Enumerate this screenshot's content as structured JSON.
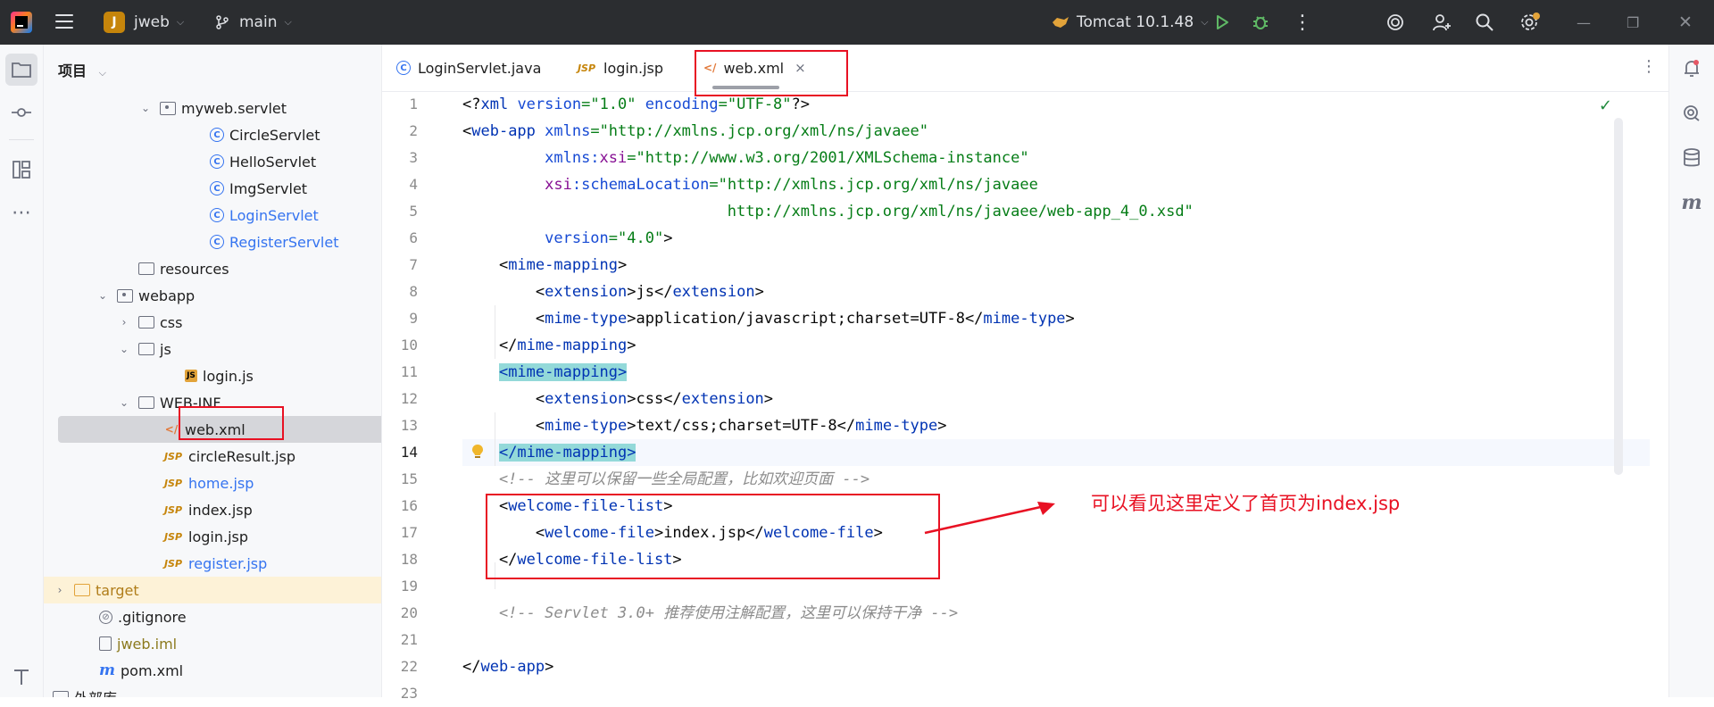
{
  "titlebar": {
    "project_badge": "J",
    "project_name": "jweb",
    "branch": "main",
    "run_config": "Tomcat 10.1.48"
  },
  "project_panel": {
    "header": "项目",
    "tree": [
      {
        "label": "myweb.servlet",
        "icon": "package-icon",
        "arrow": "⌄",
        "indent": 130
      },
      {
        "label": "CircleServlet",
        "icon": "class-icon",
        "indent": 186
      },
      {
        "label": "HelloServlet",
        "icon": "class-icon",
        "indent": 186
      },
      {
        "label": "ImgServlet",
        "icon": "class-icon",
        "indent": 186
      },
      {
        "label": "LoginServlet",
        "icon": "class-icon",
        "indent": 186,
        "color": "blue"
      },
      {
        "label": "RegisterServlet",
        "icon": "class-icon",
        "indent": 186,
        "color": "blue"
      },
      {
        "label": "resources",
        "icon": "resources-folder-icon",
        "indent": 106
      },
      {
        "label": "webapp",
        "icon": "web-folder-icon",
        "arrow": "⌄",
        "indent": 82
      },
      {
        "label": "css",
        "icon": "folder-icon",
        "arrow": "›",
        "indent": 106
      },
      {
        "label": "js",
        "icon": "folder-icon",
        "arrow": "⌄",
        "indent": 106
      },
      {
        "label": "login.js",
        "icon": "js-file-icon",
        "indent": 158
      },
      {
        "label": "WEB-INF",
        "icon": "folder-icon",
        "arrow": "⌄",
        "indent": 106
      },
      {
        "label": "web.xml",
        "icon": "xml-file-icon",
        "indent": 134,
        "selected": true
      },
      {
        "label": "circleResult.jsp",
        "icon": "jsp-file-icon",
        "indent": 134
      },
      {
        "label": "home.jsp",
        "icon": "jsp-file-icon",
        "indent": 134,
        "color": "blue"
      },
      {
        "label": "index.jsp",
        "icon": "jsp-file-icon",
        "indent": 134
      },
      {
        "label": "login.jsp",
        "icon": "jsp-file-icon",
        "indent": 134
      },
      {
        "label": "register.jsp",
        "icon": "jsp-file-icon",
        "indent": 134,
        "color": "blue"
      },
      {
        "label": "target",
        "icon": "excluded-folder-icon",
        "arrow": "›",
        "indent": 34,
        "highlight": true,
        "color": "orange"
      },
      {
        "label": ".gitignore",
        "icon": "gitignore-icon",
        "indent": 62
      },
      {
        "label": "jweb.iml",
        "icon": "iml-file-icon",
        "indent": 62,
        "color": "olive"
      },
      {
        "label": "pom.xml",
        "icon": "maven-icon",
        "indent": 62
      },
      {
        "label": "外部库",
        "icon": "library-icon",
        "arrow": "⌄",
        "indent": 10
      }
    ]
  },
  "editor": {
    "tabs": [
      {
        "label": "LoginServlet.java",
        "icon": "class-icon",
        "active": false
      },
      {
        "label": "login.jsp",
        "icon": "jsp-file-icon",
        "active": false
      },
      {
        "label": "web.xml",
        "icon": "xml-file-icon",
        "active": true,
        "close": "×"
      }
    ],
    "line_numbers": [
      "1",
      "2",
      "3",
      "4",
      "5",
      "6",
      "7",
      "8",
      "9",
      "10",
      "11",
      "12",
      "13",
      "14",
      "15",
      "16",
      "17",
      "18",
      "19",
      "20",
      "21",
      "22",
      "23"
    ],
    "current_line": 14,
    "code": [
      [
        [
          "tx",
          "<?"
        ],
        [
          "tg",
          "xml "
        ],
        [
          "at",
          "version"
        ],
        [
          "vl",
          "=\"1.0\" "
        ],
        [
          "at",
          "encoding"
        ],
        [
          "vl",
          "=\"UTF-8\""
        ],
        [
          "tx",
          "?>"
        ]
      ],
      [
        [
          "tx",
          "<"
        ],
        [
          "tg",
          "web-app "
        ],
        [
          "at",
          "xmlns"
        ],
        [
          "vl",
          "=\"http://xmlns.jcp.org/xml/ns/javaee\""
        ]
      ],
      [
        [
          "tx",
          "         "
        ],
        [
          "at",
          "xmlns:"
        ],
        [
          "ns",
          "xsi"
        ],
        [
          "vl",
          "=\"http://www.w3.org/2001/XMLSchema-instance\""
        ]
      ],
      [
        [
          "tx",
          "         "
        ],
        [
          "ns",
          "xsi"
        ],
        [
          "at",
          ":schemaLocation"
        ],
        [
          "vl",
          "=\"http://xmlns.jcp.org/xml/ns/javaee"
        ]
      ],
      [
        [
          "vl",
          "                             http://xmlns.jcp.org/xml/ns/javaee/web-app_4_0.xsd\""
        ]
      ],
      [
        [
          "tx",
          "         "
        ],
        [
          "at",
          "version"
        ],
        [
          "vl",
          "=\"4.0\""
        ],
        [
          "tx",
          ">"
        ]
      ],
      [
        [
          "tx",
          "    <"
        ],
        [
          "tg",
          "mime-mapping"
        ],
        [
          "tx",
          ">"
        ]
      ],
      [
        [
          "tx",
          "        <"
        ],
        [
          "tg",
          "extension"
        ],
        [
          "tx",
          ">js</"
        ],
        [
          "tg",
          "extension"
        ],
        [
          "tx",
          ">"
        ]
      ],
      [
        [
          "tx",
          "        <"
        ],
        [
          "tg",
          "mime-type"
        ],
        [
          "tx",
          ">application/javascript;charset=UTF-8</"
        ],
        [
          "tg",
          "mime-type"
        ],
        [
          "tx",
          ">"
        ]
      ],
      [
        [
          "tx",
          "    </"
        ],
        [
          "tg",
          "mime-mapping"
        ],
        [
          "tx",
          ">"
        ]
      ],
      [
        [
          "tx",
          "    "
        ],
        [
          "hl",
          "<mime-mapping>"
        ]
      ],
      [
        [
          "tx",
          "        <"
        ],
        [
          "tg",
          "extension"
        ],
        [
          "tx",
          ">css</"
        ],
        [
          "tg",
          "extension"
        ],
        [
          "tx",
          ">"
        ]
      ],
      [
        [
          "tx",
          "        <"
        ],
        [
          "tg",
          "mime-type"
        ],
        [
          "tx",
          ">text/css;charset=UTF-8</"
        ],
        [
          "tg",
          "mime-type"
        ],
        [
          "tx",
          ">"
        ]
      ],
      [
        [
          "tx",
          "    "
        ],
        [
          "hl",
          "</mime-mapping>"
        ]
      ],
      [
        [
          "cm",
          "    <!-- 这里可以保留一些全局配置，比如欢迎页面 -->"
        ]
      ],
      [
        [
          "tx",
          "    <"
        ],
        [
          "tg",
          "welcome-file-list"
        ],
        [
          "tx",
          ">"
        ]
      ],
      [
        [
          "tx",
          "        <"
        ],
        [
          "tg",
          "welcome-file"
        ],
        [
          "tx",
          ">index.jsp</"
        ],
        [
          "tg",
          "welcome-file"
        ],
        [
          "tx",
          ">"
        ]
      ],
      [
        [
          "tx",
          "    </"
        ],
        [
          "tg",
          "welcome-file-list"
        ],
        [
          "tx",
          ">"
        ]
      ],
      [
        [
          "tx",
          ""
        ]
      ],
      [
        [
          "cm",
          "    <!-- Servlet 3.0+ 推荐使用注解配置，这里可以保持干净 -->"
        ]
      ],
      [
        [
          "tx",
          ""
        ]
      ],
      [
        [
          "tx",
          "</"
        ],
        [
          "tg",
          "web-app"
        ],
        [
          "tx",
          ">"
        ]
      ],
      [
        [
          "tx",
          ""
        ]
      ]
    ]
  },
  "annotation": {
    "note": "可以看见这里定义了首页为index.jsp",
    "color": "#e81123"
  }
}
